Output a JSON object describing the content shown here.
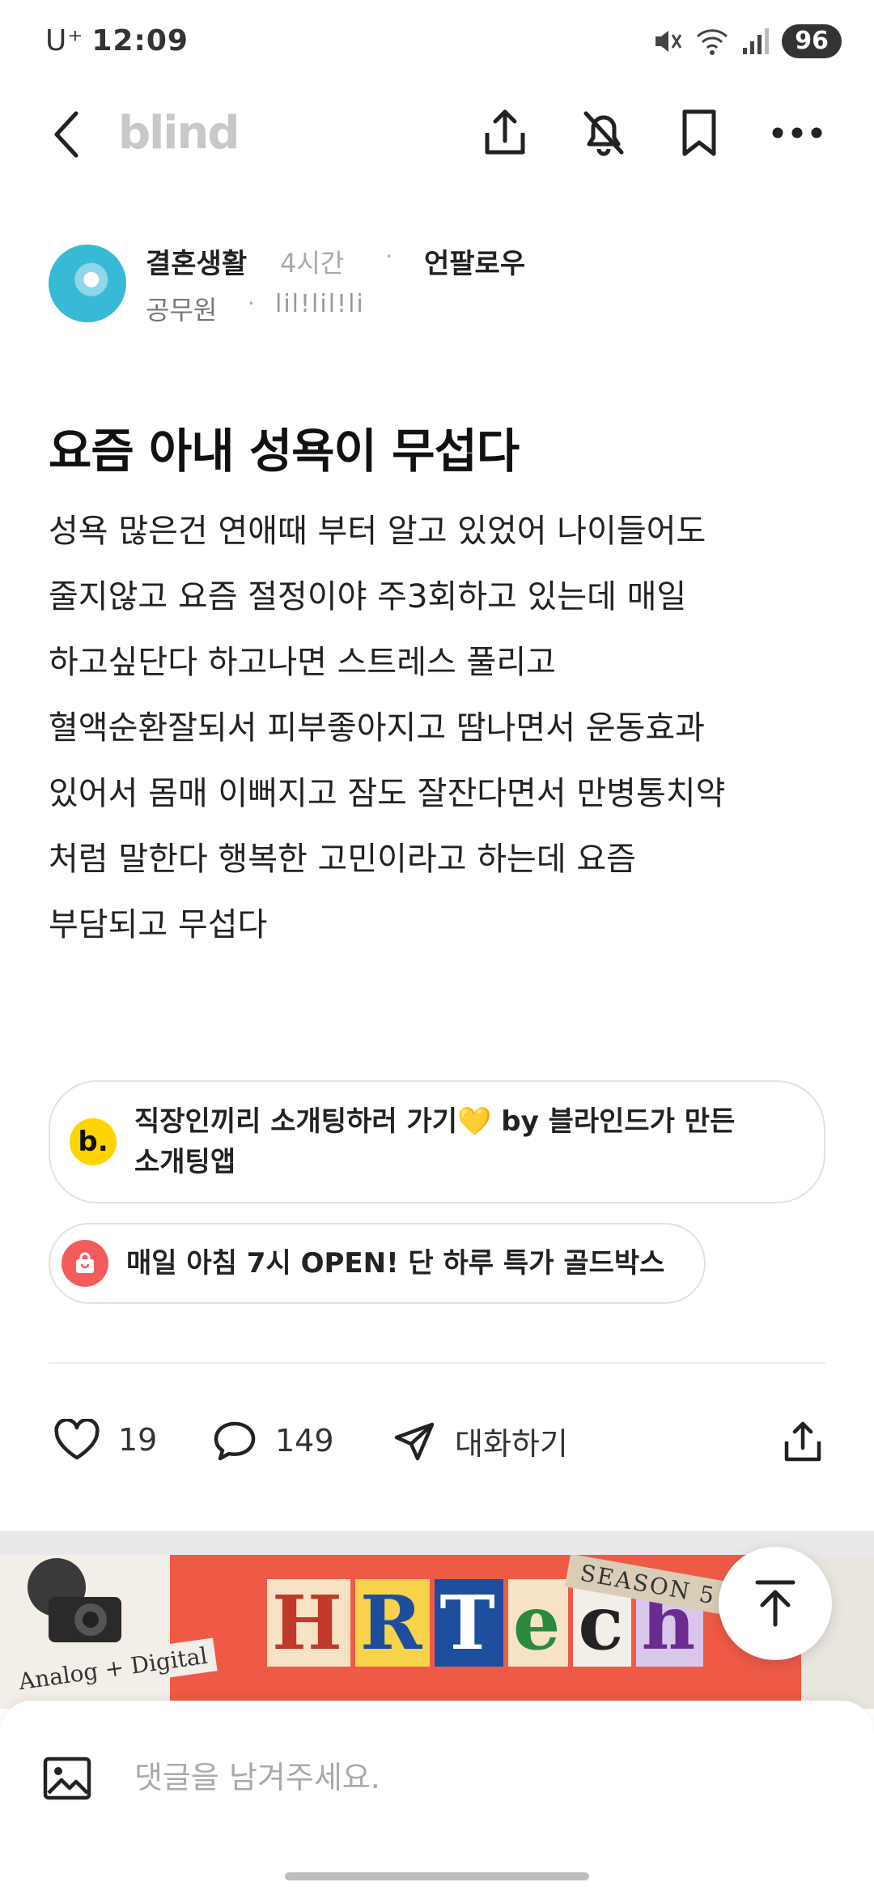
{
  "status_bar": {
    "carrier": "U⁺",
    "time": "12:09",
    "battery": "96"
  },
  "header": {
    "logo": "blind"
  },
  "author": {
    "name": "결혼생활",
    "time": "4시간",
    "dot": "·",
    "follow_label": "언팔로우",
    "company": "공무원",
    "nickname": "lil!lil!li"
  },
  "post": {
    "title": "요즘 아내 성욕이 무섭다",
    "lines": [
      "성욕 많은건 연애때 부터 알고 있었어 나이들어도",
      "줄지않고 요즘 절정이야 주3회하고 있는데 매일",
      "하고싶단다 하고나면 스트레스 풀리고",
      "혈액순환잘되서 피부좋아지고 땀나면서 운동효과",
      "있어서 몸매 이뻐지고 잠도 잘잔다면서 만병통치약",
      "처럼 말한다 행복한 고민이라고 하는데 요즘",
      "부담되고 무섭다"
    ]
  },
  "ads": [
    {
      "icon_letter": "b.",
      "text_line1": "직장인끼리 소개팅하러 가기",
      "heart": "💛",
      "text_line1_tail": " by 블라인드가 만든",
      "text_line2": "소개팅앱"
    },
    {
      "text": "매일 아침 7시 OPEN! 단 하루 특가 골드박스"
    }
  ],
  "actions": {
    "likes": "19",
    "comments": "149",
    "talk_label": "대화하기"
  },
  "banner": {
    "tag": "Analog + Digital",
    "letters": [
      "H",
      "R",
      "T",
      "e",
      "c",
      "h"
    ],
    "season": "SEASON 5"
  },
  "comment_box": {
    "placeholder": "댓글을 남겨주세요."
  }
}
